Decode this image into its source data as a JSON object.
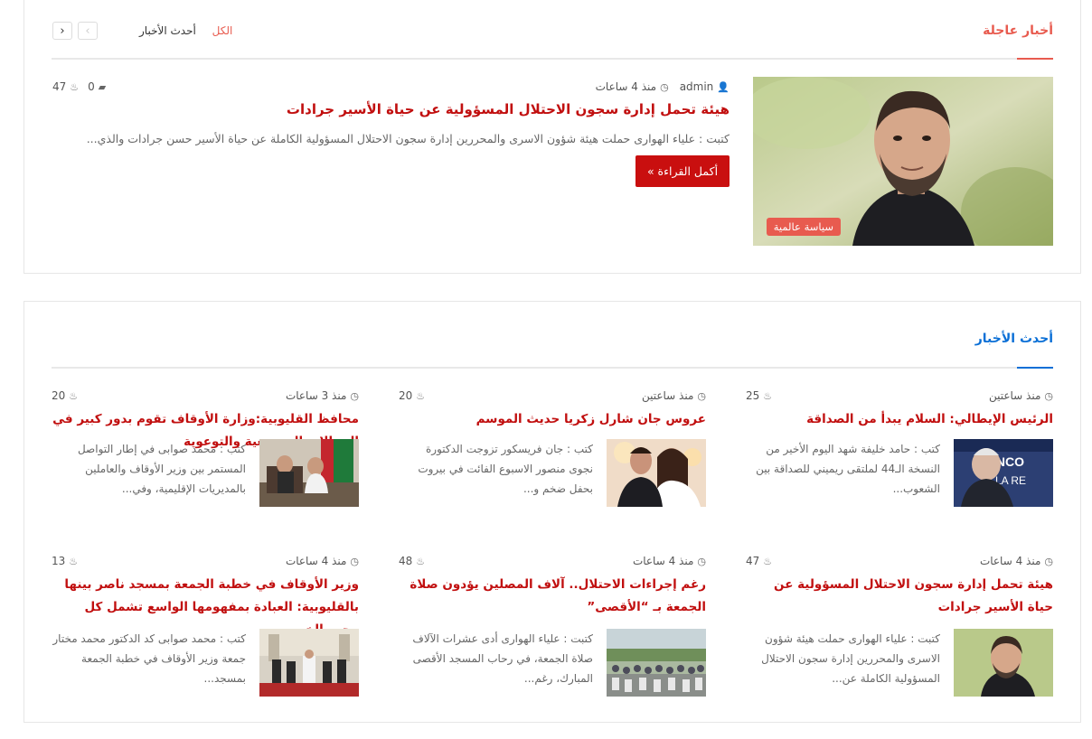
{
  "breaking": {
    "title": "أخبار عاجلة",
    "tab_all": "الكل",
    "tab_latest": "أحدث الأخبار",
    "pager_prev": "‹",
    "pager_next": "›",
    "post": {
      "author": "admin",
      "time": "منذ 4 ساعات",
      "views": "47",
      "comments": "0",
      "title": "هيئة تحمل إدارة سجون الاحتلال المسؤولية عن حياة الأسير جرادات",
      "excerpt": "كتبت : علياء الهوارى حملت هيئة شؤون الاسرى والمحررين إدارة سجون الاحتلال المسؤولية الكاملة عن حياة الأسير حسن جرادات والذي...",
      "read_more": "أكمل القراءة »",
      "category": "سياسة عالمية"
    },
    "accent_color": "#e85b4f"
  },
  "latest": {
    "title": "أحدث الأخبار",
    "accent_color": "#0a6fd6",
    "posts": [
      {
        "time": "منذ ساعتين",
        "views": "25",
        "title": "الرئيس الإيطالي: السلام يبدأ من الصداقة",
        "excerpt": "كتب : حامد خليفة شهد اليوم الأخير من النسخة الـ44 لملتقى ريميني للصداقة بين الشعوب..."
      },
      {
        "time": "منذ ساعتين",
        "views": "20",
        "title": "عروس جان شارل زكريا حديث الموسم",
        "excerpt": "كتب : جان فريسكور تزوجت الدكتورة نجوى منصور الاسبوع الفائت في بيروت بحفل ضخم و..."
      },
      {
        "time": "منذ 3 ساعات",
        "views": "20",
        "title": "محافظ القليوبية:وزارة الأوقاف تقوم بدور كبير في المجالات المجتمعية والتوعوية",
        "excerpt": "كتب : محمد صوابى في إطار التواصل المستمر بين وزير الأوقاف والعاملين بالمديريات الإقليمية، وفي..."
      },
      {
        "time": "منذ 4 ساعات",
        "views": "47",
        "title": "هيئة تحمل إدارة سجون الاحتلال المسؤولية عن حياة الأسير جرادات",
        "excerpt": "كتبت : علياء الهوارى حملت هيئة شؤون الاسرى والمحررين إدارة سجون الاحتلال المسؤولية الكاملة عن..."
      },
      {
        "time": "منذ 4 ساعات",
        "views": "48",
        "title": "رغم إجراءات الاحتلال.. آلاف المصلين يؤدون صلاة الجمعة بـ “الأقصى”",
        "excerpt": "كتبت : علياء الهوارى أدى عشرات الآلاف صلاة الجمعة، في رحاب المسجد الأقصى المبارك، رغم..."
      },
      {
        "time": "منذ 4 ساعات",
        "views": "13",
        "title": "وزير الأوقاف في خطبة الجمعة بمسجد ناصر بينها بالقليوبية: العبادة بمفهومها الواسع تشمل كل وجوه الخير",
        "excerpt": "كتب : محمد صوابى كد الدكتور محمد مختار جمعة وزير الأوقاف في خطبة الجمعة بمسجد..."
      }
    ]
  }
}
